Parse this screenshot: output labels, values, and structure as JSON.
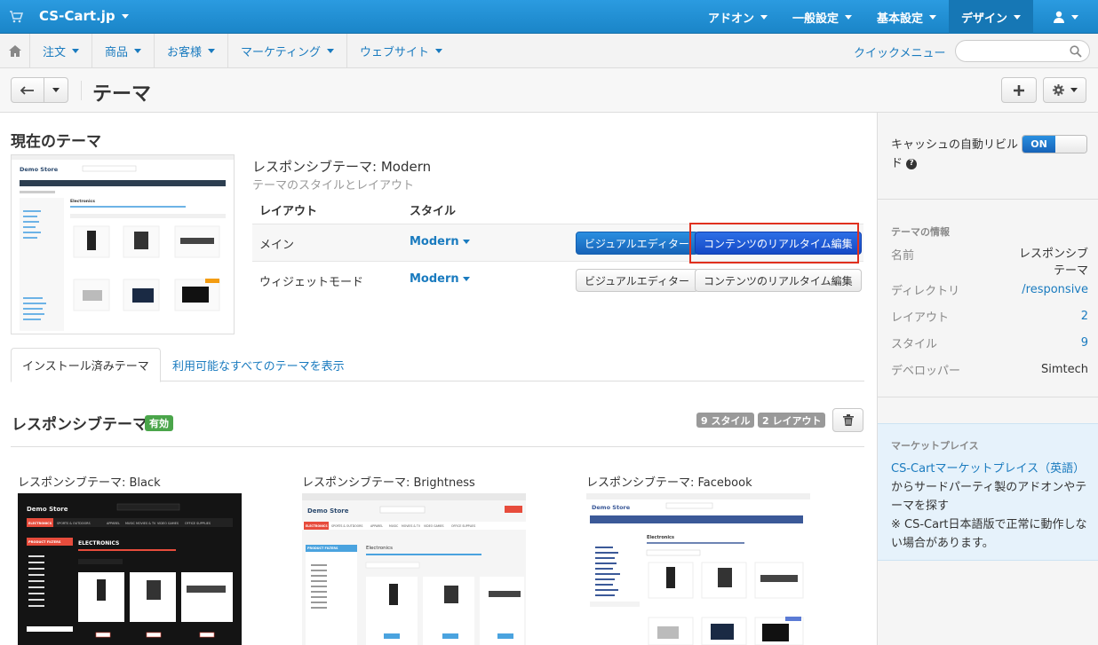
{
  "topbar": {
    "brand": "CS-Cart.jp",
    "menu": [
      {
        "label": "アドオン"
      },
      {
        "label": "一般設定"
      },
      {
        "label": "基本設定"
      },
      {
        "label": "デザイン"
      }
    ]
  },
  "navbar": {
    "items": [
      {
        "label": "注文"
      },
      {
        "label": "商品"
      },
      {
        "label": "お客様"
      },
      {
        "label": "マーケティング"
      },
      {
        "label": "ウェブサイト"
      }
    ],
    "quick_menu": "クイックメニュー",
    "search_placeholder": ""
  },
  "titlebar": {
    "title": "テーマ"
  },
  "current": {
    "heading": "現在のテーマ",
    "theme_name": "レスポンシブテーマ: Modern",
    "theme_desc": "テーマのスタイルとレイアウト",
    "col_layout": "レイアウト",
    "col_style": "スタイル",
    "layouts": [
      {
        "name": "メイン",
        "style": "Modern",
        "visual_btn": "ビジュアルエディター",
        "live_btn": "コンテンツのリアルタイム編集"
      },
      {
        "name": "ウィジェットモード",
        "style": "Modern",
        "visual_btn": "ビジュアルエディター",
        "live_btn": "コンテンツのリアルタイム編集"
      }
    ]
  },
  "tabs": [
    {
      "label": "インストール済みテーマ"
    },
    {
      "label": "利用可能なすべてのテーマを表示"
    }
  ],
  "section": {
    "title": "レスポンシブテーマ",
    "status": "有効",
    "styles_badge": "9 スタイル",
    "layouts_badge": "2 レイアウト"
  },
  "cards": [
    {
      "title": "レスポンシブテーマ: Black"
    },
    {
      "title": "レスポンシブテーマ: Brightness"
    },
    {
      "title": "レスポンシブテーマ: Facebook"
    }
  ],
  "thumb": {
    "logo": "Demo Store",
    "category": "ELECTRONICS",
    "filters": "PRODUCT FILTERS",
    "electronics": "Electronics",
    "nav": [
      "ELECTRONICS",
      "SPORTS & OUTDOORS",
      "APPAREL",
      "MUSIC",
      "MOVIES & TV",
      "VIDEO GAMES",
      "OFFICE SUPPLIES"
    ]
  },
  "sidebar": {
    "cache_label": "キャッシュの自動リビルド",
    "cache_state": "ON",
    "info_title": "テーマの情報",
    "info": [
      {
        "key": "名前",
        "value": "レスポンシブテーマ"
      },
      {
        "key": "ディレクトリ",
        "value": "/responsive"
      },
      {
        "key": "レイアウト",
        "value": "2"
      },
      {
        "key": "スタイル",
        "value": "9"
      },
      {
        "key": "デベロッパー",
        "value": "Simtech"
      }
    ],
    "market_title": "マーケットプレイス",
    "market_link": "CS-Cartマーケットプレイス（英語）",
    "market_text1": "からサードパーティ製のアドオンやテーマを探す",
    "market_text2": "※ CS-Cart日本語版で正常に動作しない場合があります。"
  },
  "colors": {
    "topbar": "#1f8fd4",
    "link": "#1a7bbf",
    "primary_button": "#1763b8",
    "highlight_box": "#e0301e",
    "active_badge": "#4aa54a"
  }
}
